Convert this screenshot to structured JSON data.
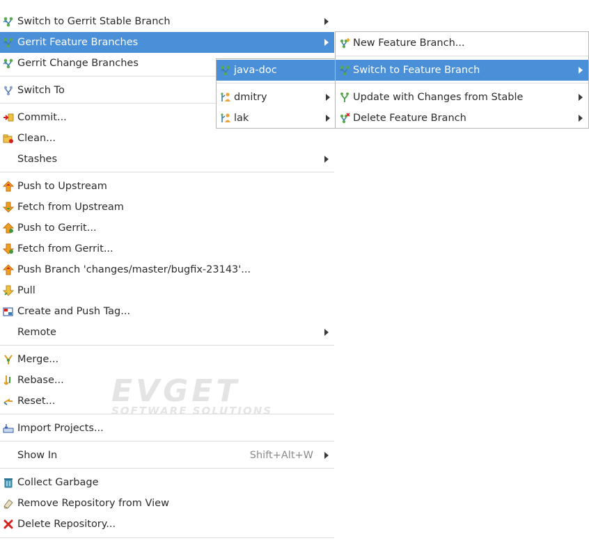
{
  "main_menu": {
    "items": [
      {
        "label": "Switch to Gerrit Stable Branch",
        "icon": "gerrit-branch-icon"
      },
      {
        "label": "Gerrit Feature Branches",
        "icon": "gerrit-branch-icon",
        "selected": true
      },
      {
        "label": "Gerrit Change Branches",
        "icon": "gerrit-branch-icon"
      },
      {
        "label": "Switch To",
        "icon": "switch-branch-icon"
      },
      {
        "label": "Commit...",
        "icon": "commit-icon"
      },
      {
        "label": "Clean...",
        "icon": "clean-icon"
      },
      {
        "label": "Stashes"
      },
      {
        "label": "Push to Upstream",
        "icon": "push-icon"
      },
      {
        "label": "Fetch from Upstream",
        "icon": "fetch-icon"
      },
      {
        "label": "Push to Gerrit...",
        "icon": "push-gerrit-icon"
      },
      {
        "label": "Fetch from Gerrit...",
        "icon": "fetch-gerrit-icon"
      },
      {
        "label": "Push Branch 'changes/master/bugfix-23143'...",
        "icon": "push-branch-icon"
      },
      {
        "label": "Pull",
        "icon": "pull-icon"
      },
      {
        "label": "Create and Push Tag...",
        "icon": "tag-icon"
      },
      {
        "label": "Remote"
      },
      {
        "label": "Merge...",
        "icon": "merge-icon"
      },
      {
        "label": "Rebase...",
        "icon": "rebase-icon"
      },
      {
        "label": "Reset...",
        "icon": "reset-icon"
      },
      {
        "label": "Import Projects...",
        "icon": "import-icon"
      },
      {
        "label": "Show In",
        "accelerator": "Shift+Alt+W"
      },
      {
        "label": "Collect Garbage",
        "icon": "trash-icon"
      },
      {
        "label": "Remove Repository from View",
        "icon": "eraser-icon"
      },
      {
        "label": "Delete Repository...",
        "icon": "delete-icon"
      }
    ]
  },
  "submenu_branches": {
    "items": [
      {
        "label": "java-doc",
        "selected": true
      },
      {
        "label": "dmitry"
      },
      {
        "label": "lak"
      }
    ]
  },
  "submenu_feature": {
    "items": [
      {
        "label": "New Feature Branch..."
      },
      {
        "label": "Switch to Feature Branch",
        "selected": true
      },
      {
        "label": "Update with Changes from Stable"
      },
      {
        "label": "Delete Feature Branch"
      }
    ]
  },
  "watermark": {
    "line1": "EVGET",
    "line2": "SOFTWARE SOLUTIONS"
  },
  "colors": {
    "selection": "#4a90d9",
    "gerrit_green": "#3f9a3f",
    "push_orange": "#f0a020",
    "delete_red": "#d62020"
  }
}
